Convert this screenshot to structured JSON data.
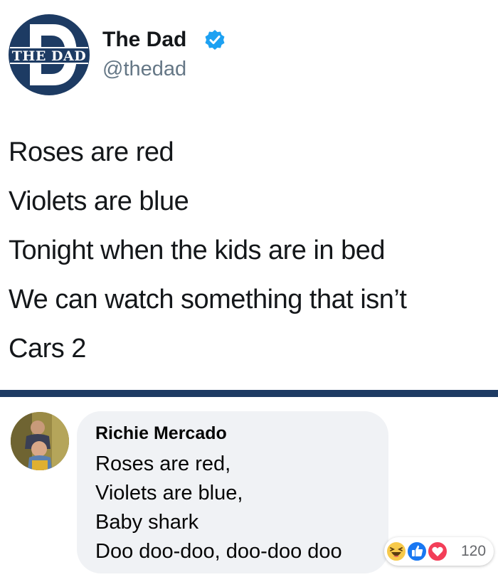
{
  "tweet": {
    "display_name": "The Dad",
    "handle": "@thedad",
    "avatar_logo_text": "THE DAD",
    "lines": [
      "Roses are red",
      "Violets are blue",
      "Tonight when the kids are in bed",
      "We can watch something that isn’t",
      "Cars 2"
    ]
  },
  "comment": {
    "author": "Richie Mercado",
    "lines": [
      "Roses are red,",
      "Violets are blue,",
      "Baby shark",
      "Doo doo-doo, doo-doo doo"
    ],
    "reactions": {
      "icons": [
        "haha-icon",
        "like-icon",
        "love-icon"
      ],
      "count": "120"
    }
  },
  "colors": {
    "navy": "#1d3b63",
    "verified_blue": "#1da1f2",
    "bubble_gray": "#f0f2f5",
    "handle_gray": "#657786"
  }
}
